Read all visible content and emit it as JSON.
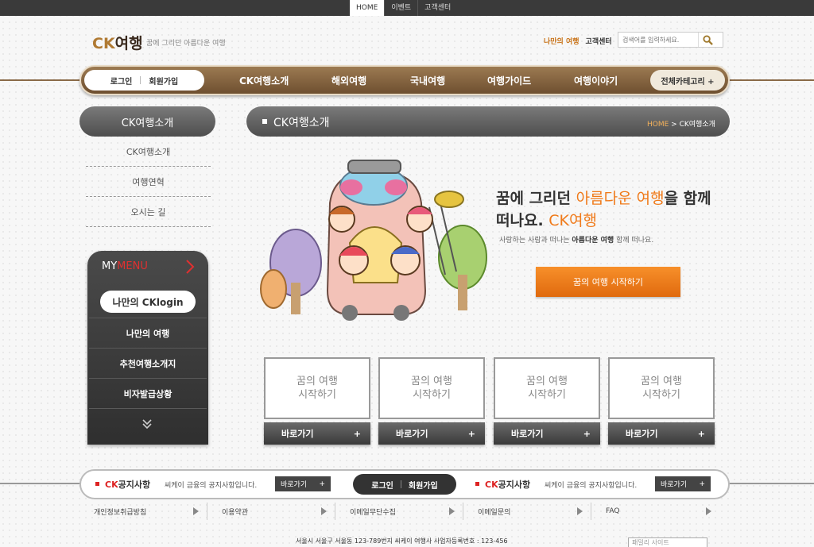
{
  "topnav": {
    "items": [
      "HOME",
      "이벤트",
      "고객센터"
    ]
  },
  "header": {
    "logo_brand": "CK",
    "logo_text": "여행",
    "tagline": "꿈에 그리던 아름다운 여행",
    "link_my": "나만의 여행",
    "link_cs": "고객센터",
    "search_placeholder": "검색어를 입력하세요."
  },
  "nav": {
    "login": "로그인",
    "join": "회원가입",
    "items": [
      "CK여행소개",
      "해외여행",
      "국내여행",
      "여행가이드",
      "여행이야기"
    ],
    "all_category": "전체카테고리 +"
  },
  "sidebar": {
    "title": "CK여행소개",
    "items": [
      "CK여행소개",
      "여행연혁",
      "오시는 길"
    ]
  },
  "mymenu": {
    "title_a": "MY",
    "title_b": "MENU",
    "login": "나만의 CKlogin",
    "items": [
      "나만의 여행",
      "추천여행소개지",
      "비자발급상황"
    ]
  },
  "content": {
    "title": "CK여행소개",
    "crumb_home": "HOME",
    "crumb_sep": " > ",
    "crumb_current": "CK여행소개"
  },
  "hero": {
    "line1_a": "꿈에 그리던 ",
    "line1_b": "아름다운 여행",
    "line1_c": "을 함께",
    "line2_a": "떠나요. ",
    "line2_b": "CK여행",
    "sub_a": "사랑하는 사람과 떠나는 ",
    "sub_b": "아름다운 여행",
    "sub_c": " 함께 떠나요.",
    "button": "꿈의 여행 시작하기"
  },
  "cards": [
    {
      "line1": "꿈의 여행",
      "line2": "시작하기",
      "button": "바로가기",
      "plus": "+"
    },
    {
      "line1": "꿈의 여행",
      "line2": "시작하기",
      "button": "바로가기",
      "plus": "+"
    },
    {
      "line1": "꿈의 여행",
      "line2": "시작하기",
      "button": "바로가기",
      "plus": "+"
    },
    {
      "line1": "꿈의 여행",
      "line2": "시작하기",
      "button": "바로가기",
      "plus": "+"
    }
  ],
  "footer": {
    "notice_brand": "CK",
    "notice_label": "공지사항",
    "notice_text": "씨케이 금융의 공지사항입니다.",
    "notice_btn": "바로가기",
    "notice_plus": "+",
    "login": "로그인",
    "join": "회원가입",
    "links": [
      "개인정보취급방침",
      "이용약관",
      "이메일무단수집",
      "이메일문의",
      "FAQ"
    ],
    "address": "서울시 서울구 서울동 123-789번지 씨케이 여행사 사업자등록번호 : 123-456",
    "family_site": "패밀리 사이트"
  },
  "colors": {
    "accent_orange": "#f07a1a",
    "nav_brown": "#8a6a48",
    "notice_red": "#dd2222",
    "dark_gray": "#4e4e4e"
  }
}
